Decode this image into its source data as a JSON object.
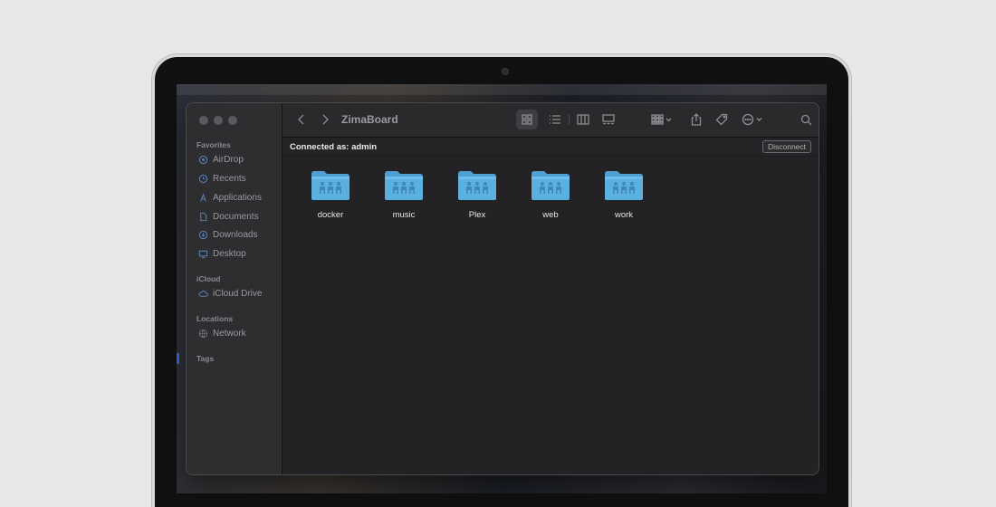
{
  "window": {
    "title": "ZimaBoard"
  },
  "sidebar": {
    "sections": [
      {
        "label": "Favorites"
      },
      {
        "label": "iCloud"
      },
      {
        "label": "Locations"
      },
      {
        "label": "Tags"
      }
    ],
    "items": [
      {
        "label": "AirDrop",
        "icon": "airdrop-icon"
      },
      {
        "label": "Recents",
        "icon": "clock-icon"
      },
      {
        "label": "Applications",
        "icon": "applications-icon"
      },
      {
        "label": "Documents",
        "icon": "document-icon"
      },
      {
        "label": "Downloads",
        "icon": "download-icon"
      },
      {
        "label": "Desktop",
        "icon": "desktop-icon"
      },
      {
        "label": "iCloud Drive",
        "icon": "cloud-icon"
      },
      {
        "label": "Network",
        "icon": "globe-icon"
      }
    ]
  },
  "connection": {
    "label": "Connected as: admin",
    "disconnect_label": "Disconnect"
  },
  "folders": [
    {
      "name": "docker"
    },
    {
      "name": "music"
    },
    {
      "name": "Plex"
    },
    {
      "name": "web"
    },
    {
      "name": "work"
    }
  ],
  "colors": {
    "folder_blue": "#5bb0e0",
    "window_bg": "#232325",
    "sidebar_bg": "#2e2e31"
  }
}
